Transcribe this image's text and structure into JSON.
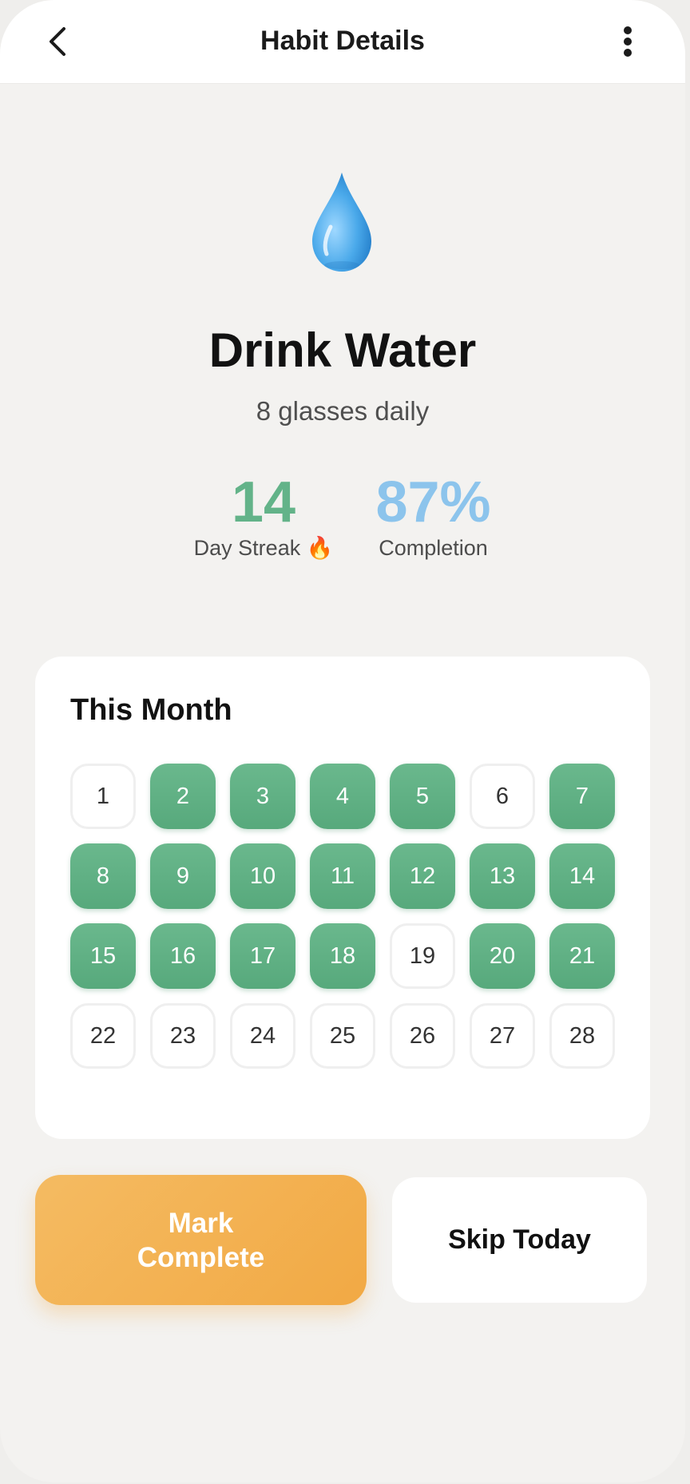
{
  "header": {
    "title": "Habit Details",
    "back_icon": "chevron-left-icon",
    "menu_icon": "more-vertical-icon"
  },
  "habit": {
    "icon": "water-drop-icon",
    "name": "Drink Water",
    "subtitle": "8 glasses daily"
  },
  "stats": {
    "streak_value": "14",
    "streak_label": "Day Streak 🔥",
    "completion_value": "87%",
    "completion_label": "Completion"
  },
  "calendar": {
    "title": "This Month",
    "days": [
      {
        "day": "1",
        "done": false
      },
      {
        "day": "2",
        "done": true
      },
      {
        "day": "3",
        "done": true
      },
      {
        "day": "4",
        "done": true
      },
      {
        "day": "5",
        "done": true
      },
      {
        "day": "6",
        "done": false
      },
      {
        "day": "7",
        "done": true
      },
      {
        "day": "8",
        "done": true
      },
      {
        "day": "9",
        "done": true
      },
      {
        "day": "10",
        "done": true
      },
      {
        "day": "11",
        "done": true
      },
      {
        "day": "12",
        "done": true
      },
      {
        "day": "13",
        "done": true
      },
      {
        "day": "14",
        "done": true
      },
      {
        "day": "15",
        "done": true
      },
      {
        "day": "16",
        "done": true
      },
      {
        "day": "17",
        "done": true
      },
      {
        "day": "18",
        "done": true
      },
      {
        "day": "19",
        "done": false
      },
      {
        "day": "20",
        "done": true
      },
      {
        "day": "21",
        "done": true
      },
      {
        "day": "22",
        "done": false
      },
      {
        "day": "23",
        "done": false
      },
      {
        "day": "24",
        "done": false
      },
      {
        "day": "25",
        "done": false
      },
      {
        "day": "26",
        "done": false
      },
      {
        "day": "27",
        "done": false
      },
      {
        "day": "28",
        "done": false
      }
    ]
  },
  "actions": {
    "complete_label": "Mark Complete",
    "skip_label": "Skip Today"
  },
  "colors": {
    "streak": "#63b389",
    "completion": "#8cc4ec",
    "done_day": "#5fb184",
    "primary_button": "#f3b254"
  }
}
